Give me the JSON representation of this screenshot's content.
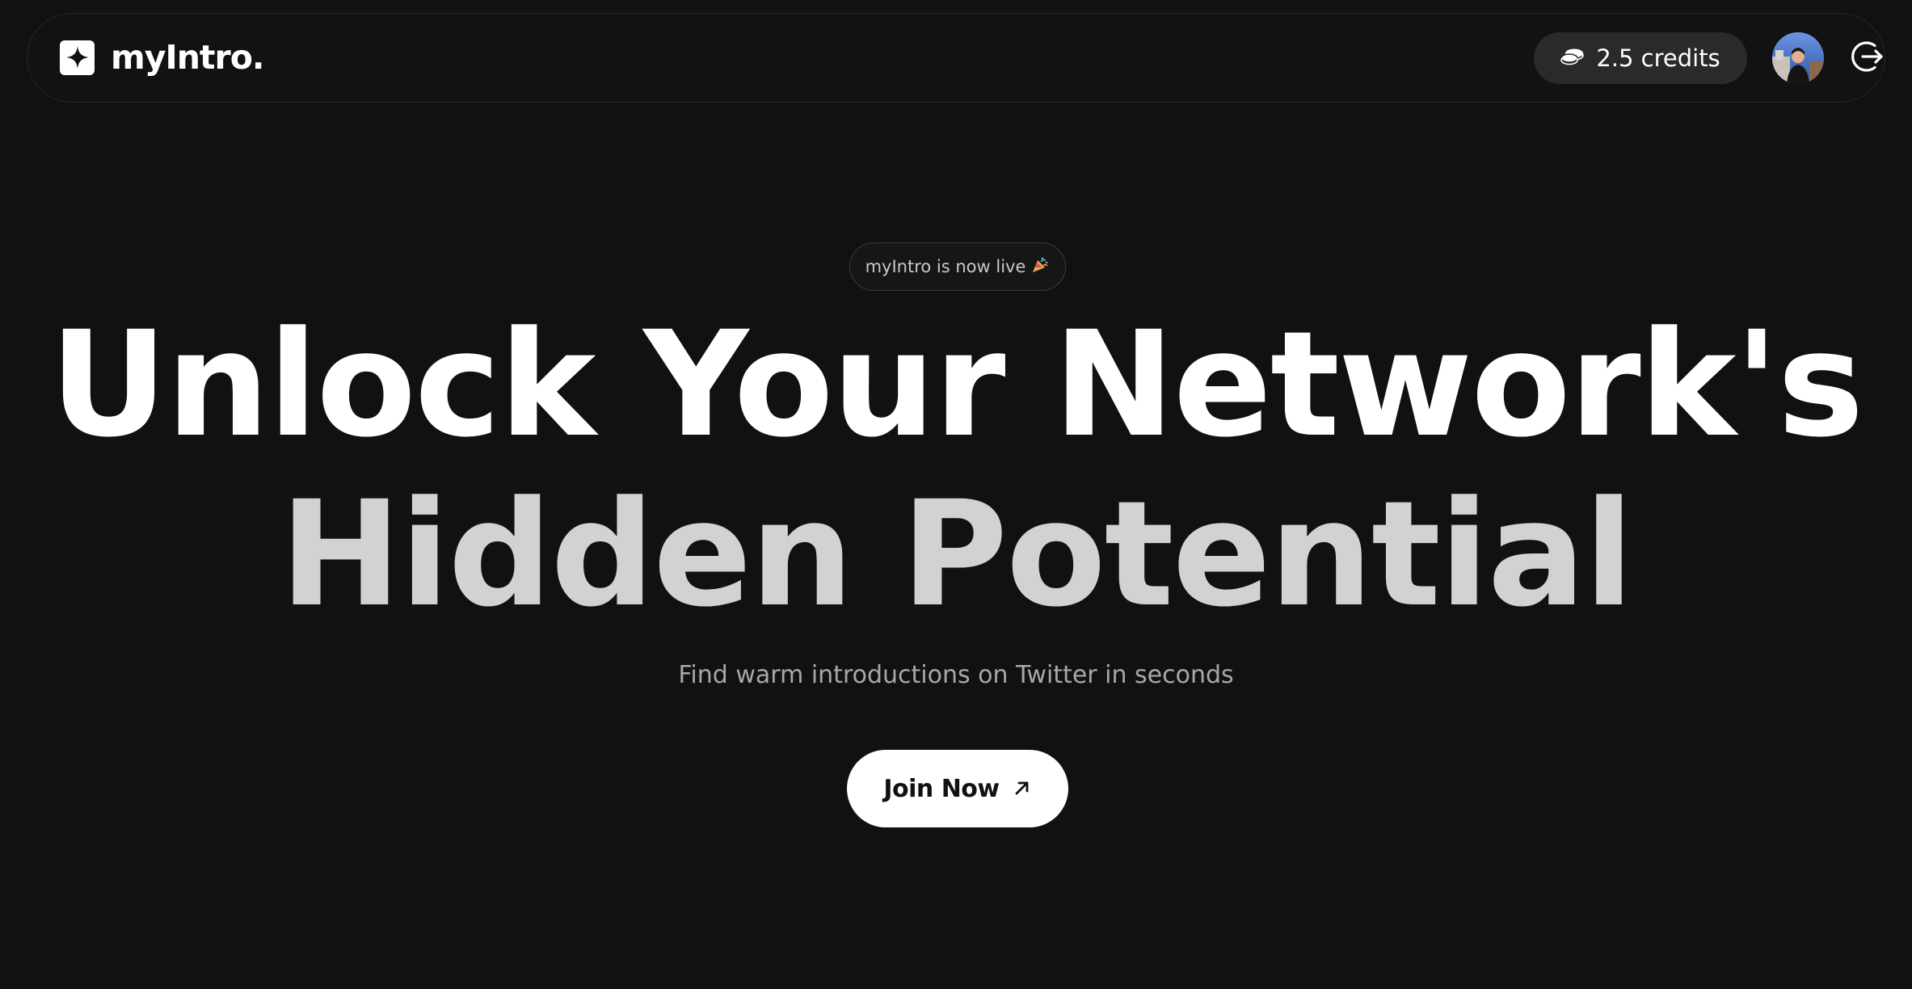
{
  "navbar": {
    "brand_name": "myIntro.",
    "credits_label": "2.5 credits"
  },
  "hero": {
    "badge_text": "myIntro is now live",
    "headline_line1": "Unlock Your Network's",
    "headline_line2": "Hidden Potential",
    "subheadline": "Find warm introductions on Twitter in seconds",
    "cta_label": "Join Now"
  },
  "icons": {
    "brand_logo": "sparkle-icon",
    "credits": "coins-icon",
    "badge": "party-popper-icon",
    "logout": "logout-icon",
    "cta": "arrow-up-right-icon"
  },
  "colors": {
    "background": "#111111",
    "text_primary": "#ffffff",
    "headline_secondary": "#d2d2d2",
    "subtext": "#a8a8a8",
    "pill_background": "#2a2a2a",
    "cta_background": "#ffffff",
    "cta_text": "#111111"
  }
}
